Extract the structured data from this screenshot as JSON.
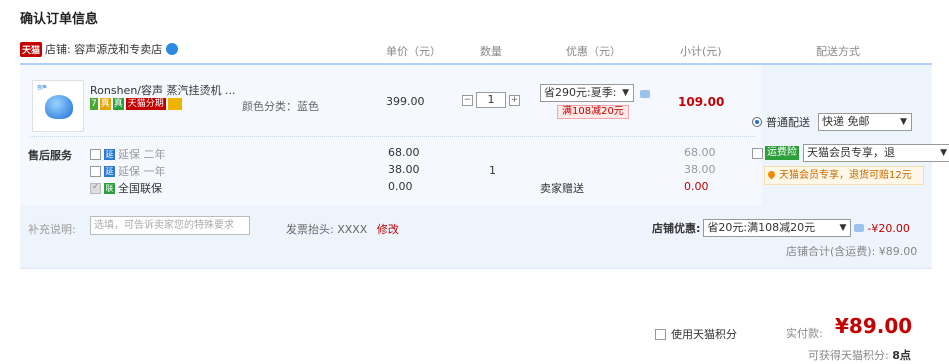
{
  "page": {
    "title": "确认订单信息"
  },
  "header": {
    "shop_prefix": "天猫",
    "shop_label": "店铺: 容声源茂和专卖店",
    "col_price": "单价（元）",
    "col_qty": "数量",
    "col_promo": "优惠（元）",
    "col_subtotal": "小计(元)",
    "col_shipping": "配送方式"
  },
  "item": {
    "name": "Ronshen/容声 蒸汽挂烫机 ...",
    "badges": [
      "7",
      "真",
      "真",
      "天猫分期",
      ""
    ],
    "color_spec": "颜色分类：蓝色",
    "price": "399.00",
    "qty": "1",
    "promo_select": "省290元:夏季:",
    "promo_tag": "满108减20元",
    "subtotal": "109.00",
    "thumb_brand": "容声"
  },
  "service": {
    "title": "售后服务",
    "rows": [
      {
        "label": "延保 二年",
        "icon": "延",
        "price": "68.00",
        "subtotal": "68.00"
      },
      {
        "label": "延保 一年",
        "icon": "延",
        "price": "38.00",
        "subtotal": "38.00"
      },
      {
        "label": "全国联保",
        "icon": "联",
        "price": "0.00",
        "subtotal": "0.00"
      }
    ],
    "qty": "1",
    "seller_gift": "卖家赠送"
  },
  "shipping": {
    "option_label": "普通配送",
    "select_value": "快递 免邮",
    "insurance_tag": "运费险",
    "insurance_select": "天猫会员专享，退",
    "insurance_note": "天猫会员专享，退货可赔12元"
  },
  "footer_row": {
    "memo_label": "补充说明:",
    "memo_placeholder": "选填，可告诉卖家您的特殊要求",
    "invoice_label": "发票抬头: XXXX",
    "invoice_edit": "修改",
    "shop_discount_label": "店铺优惠:",
    "shop_discount_select": "省20元:满108减20元",
    "shop_discount_amount": "-¥20.00",
    "shop_total": "店铺合计(含运费): ¥89.00"
  },
  "summary": {
    "points_label": "使用天猫积分",
    "pay_label": "实付款:",
    "pay_amount": "¥89.00",
    "earn_label": "可获得天猫积分:",
    "earn_points": "8点"
  },
  "colors": {
    "accent_red": "#c40000",
    "link_blue": "#1d6fd6",
    "panel_bg": "#eef4fc"
  }
}
